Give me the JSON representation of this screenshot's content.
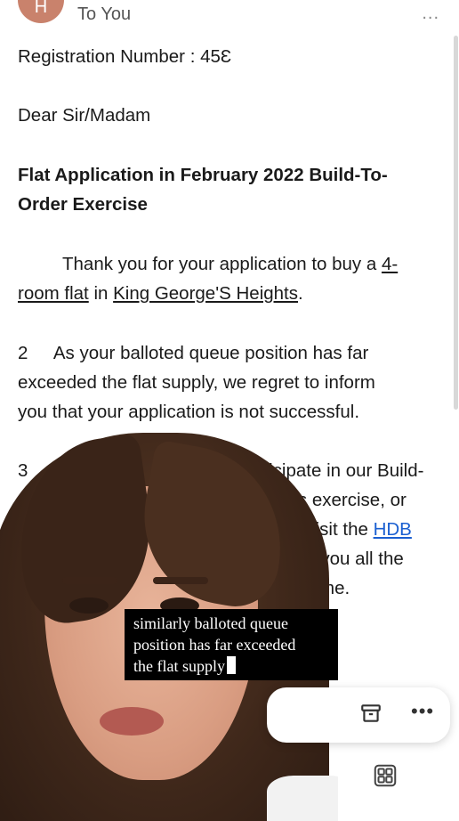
{
  "header": {
    "avatar_letter": "H",
    "recipient": "To You",
    "more_label": "..."
  },
  "email": {
    "registration_line": "Registration Number : 45Ɛ",
    "greeting": "Dear Sir/Madam",
    "subject_line1": "Flat Application in February 2022 Build-To-",
    "subject_line2": "Order Exercise",
    "para1_prefix": "Thank you for your application to buy a ",
    "para1_link1a": "4-",
    "para1_link1b": "room flat",
    "para1_mid": " in ",
    "para1_link2": "King George'S Heights",
    "para1_suffix": ".",
    "para2_line1": "2     As your balloted queue position has far",
    "para2_line2": "exceeded the flat supply, we regret to inform",
    "para2_line3": "you that your application is not successful.",
    "para3_num": "3",
    "para3_line1": "to participate in our Build-",
    "para3_line2": "nce Flats exercise, or",
    "para3_line3_prefix": "Please visit the ",
    "para3_link": "HDB",
    "para3_line4": "Ve wish you all the",
    "para3_line5": "g a home."
  },
  "caption": {
    "line1": "similarly balloted queue",
    "line2": "position has far exceeded",
    "line3": "the flat supply"
  },
  "toolbar": {
    "more_label": "•••"
  },
  "colors": {
    "link": "#1a5fd1",
    "avatar": "#c9826c"
  },
  "icons": [
    "archive-icon",
    "more-icon",
    "grid-icon"
  ]
}
